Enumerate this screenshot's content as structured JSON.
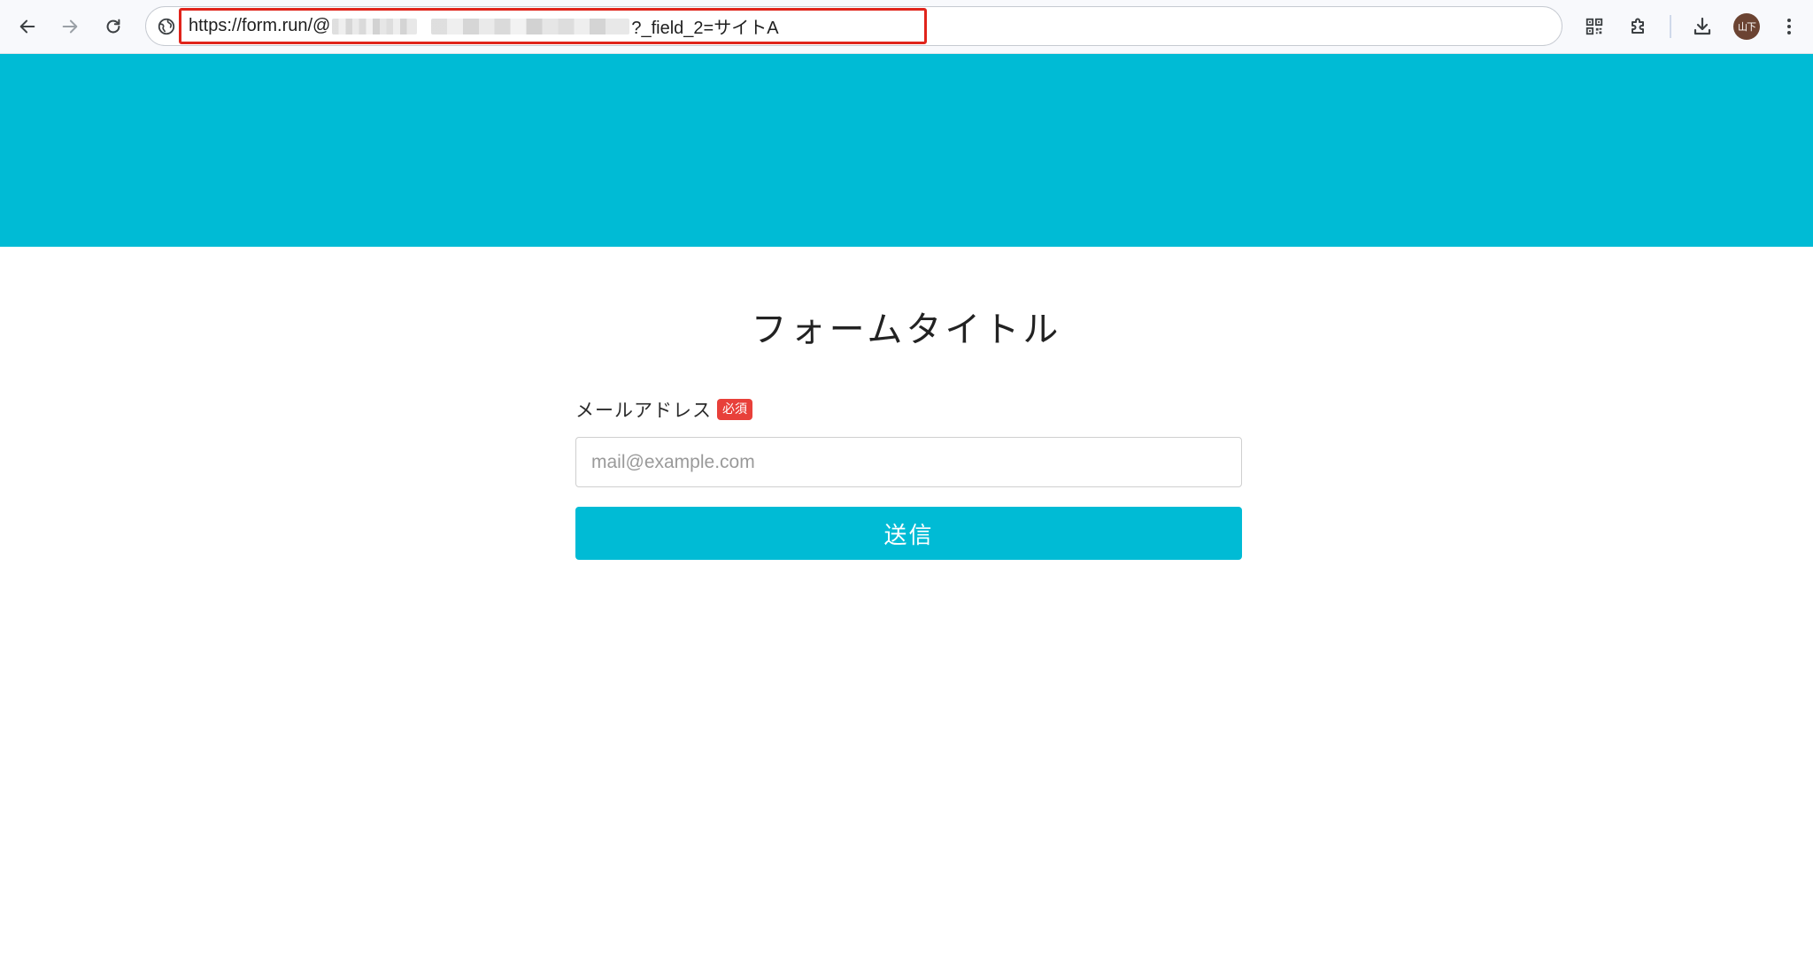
{
  "browser": {
    "url_visible_prefix": "https://form.run/@",
    "url_visible_suffix": "?_field_2=サイトA",
    "profile_initials": "山下"
  },
  "form": {
    "title": "フォームタイトル",
    "email_label": "メールアドレス",
    "required_badge": "必須",
    "email_placeholder": "mail@example.com",
    "email_value": "",
    "submit_label": "送信"
  },
  "colors": {
    "accent": "#00bbd5",
    "required": "#e8403a",
    "url_highlight": "#e0241b",
    "avatar": "#6b4332"
  }
}
